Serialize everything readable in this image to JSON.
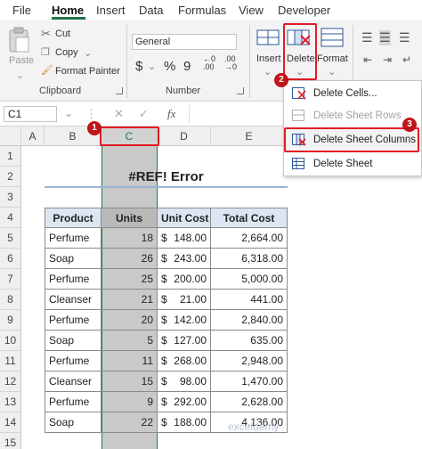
{
  "tabs": [
    "File",
    "Home",
    "Insert",
    "Data",
    "Formulas",
    "View",
    "Developer"
  ],
  "clipboard": {
    "paste": "Paste",
    "cut": "Cut",
    "copy": "Copy",
    "format_painter": "Format Painter",
    "group": "Clipboard"
  },
  "number": {
    "format": "General",
    "group": "Number",
    "currency": "$",
    "percent": "%",
    "comma": "9"
  },
  "cells_group": {
    "insert": "Insert",
    "delete": "Delete",
    "format": "Format"
  },
  "formula_bar": {
    "name_box": "C1",
    "fx": "fx"
  },
  "columns": [
    "A",
    "B",
    "C",
    "D",
    "E"
  ],
  "rows": [
    "1",
    "2",
    "3",
    "4",
    "5",
    "6",
    "7",
    "8",
    "9",
    "10",
    "11",
    "12",
    "13",
    "14",
    "15"
  ],
  "sheet_title": "#REF! Error",
  "table": {
    "headers": [
      "Product",
      "Units",
      "Unit Cost",
      "Total Cost"
    ],
    "rows": [
      [
        "Perfume",
        "18",
        "$",
        "148.00",
        "2,664.00"
      ],
      [
        "Soap",
        "26",
        "$",
        "243.00",
        "6,318.00"
      ],
      [
        "Perfume",
        "25",
        "$",
        "200.00",
        "5,000.00"
      ],
      [
        "Cleanser",
        "21",
        "$",
        "21.00",
        "441.00"
      ],
      [
        "Perfume",
        "20",
        "$",
        "142.00",
        "2,840.00"
      ],
      [
        "Soap",
        "5",
        "$",
        "127.00",
        "635.00"
      ],
      [
        "Perfume",
        "11",
        "$",
        "268.00",
        "2,948.00"
      ],
      [
        "Cleanser",
        "15",
        "$",
        "98.00",
        "1,470.00"
      ],
      [
        "Perfume",
        "9",
        "$",
        "292.00",
        "2,628.00"
      ],
      [
        "Soap",
        "22",
        "$",
        "188.00",
        "4,136.00"
      ]
    ]
  },
  "menu": {
    "items": [
      "Delete Cells...",
      "Delete Sheet Rows",
      "Delete Sheet Columns",
      "Delete Sheet"
    ]
  },
  "badges": [
    "1",
    "2",
    "3"
  ],
  "watermark": "exceldemy",
  "colors": {
    "accent": "#217346",
    "highlight": "#e31b23",
    "badge": "#c0141b",
    "header_fill": "#dce6f2"
  }
}
